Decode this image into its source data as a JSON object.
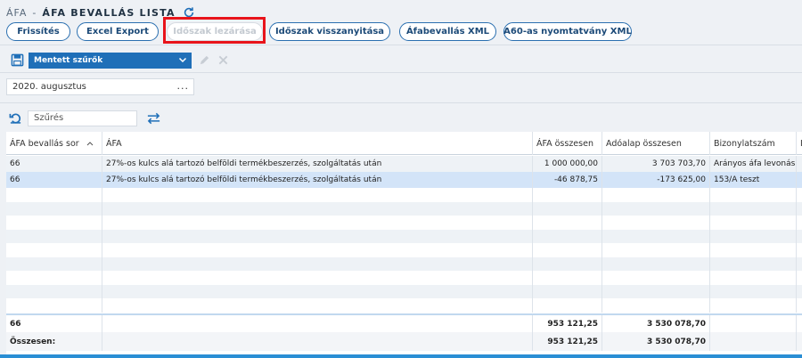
{
  "header": {
    "crumb": "ÁFA",
    "separator": "-",
    "title": "ÁFA BEVALLÁS LISTA"
  },
  "toolbar": {
    "buttons": [
      {
        "label": "Frissítés",
        "enabled": true
      },
      {
        "label": "Excel Export",
        "enabled": true
      },
      {
        "label": "Időszak lezárása",
        "enabled": false
      },
      {
        "label": "Időszak visszanyitása",
        "enabled": true
      },
      {
        "label": "Áfabevallás XML",
        "enabled": true
      },
      {
        "label": "A60-as nyomtatvány XML",
        "enabled": true
      }
    ]
  },
  "filters": {
    "saved_filters_label": "Mentett szűrők"
  },
  "period": {
    "value": "2020. augusztus",
    "dots": "..."
  },
  "search": {
    "placeholder": "Szűrés"
  },
  "table": {
    "columns": [
      "ÁFA bevallás sor",
      "ÁFA",
      "ÁFA összesen",
      "Adóalap összesen",
      "Bizonylatszám",
      "I"
    ],
    "rows": [
      [
        "66",
        "27%-os kulcs alá tartozó belföldi termékbeszerzés, szolgáltatás után",
        "1 000 000,00",
        "3 703 703,70",
        "Arányos áfa levonás s:",
        ""
      ],
      [
        "66",
        "27%-os kulcs alá tartozó belföldi termékbeszerzés, szolgáltatás után",
        "-46 878,75",
        "-173 625,00",
        "153/A teszt",
        ""
      ]
    ],
    "selected_row": 1,
    "group_total": {
      "label": "66",
      "afa_total": "953 121,25",
      "base_total": "3 530 078,70"
    },
    "grand_total": {
      "label": "Összesen:",
      "afa_total": "953 121,25",
      "base_total": "3 530 078,70"
    }
  },
  "colors": {
    "accent": "#1f6fb8",
    "highlight": "#e8141b",
    "selected_row": "#d3e4f8"
  }
}
